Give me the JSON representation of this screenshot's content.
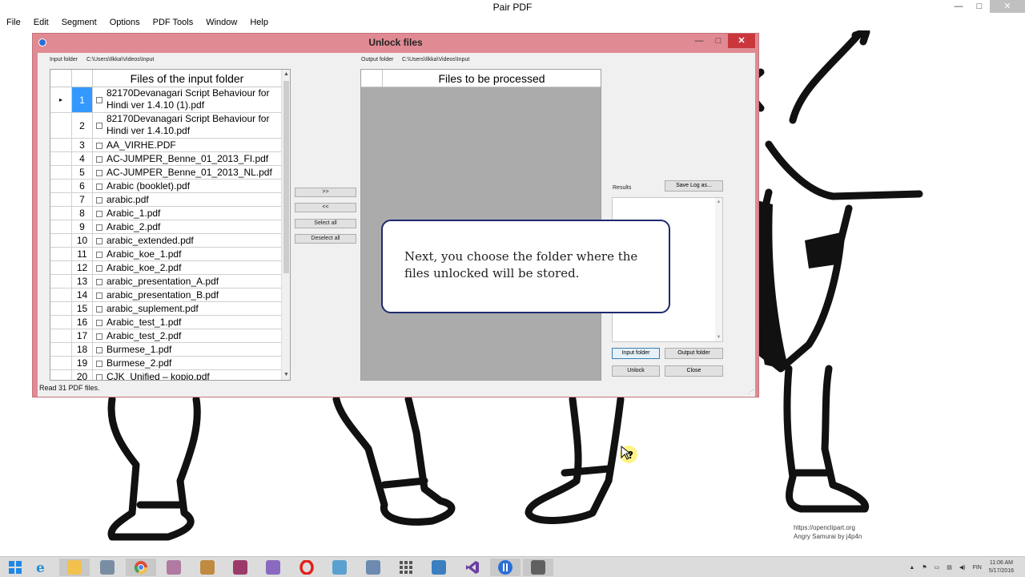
{
  "window": {
    "title": "Pair PDF",
    "caption_min": "—",
    "caption_max": "□",
    "caption_close": "✕"
  },
  "menu": [
    "File",
    "Edit",
    "Segment",
    "Options",
    "PDF Tools",
    "Window",
    "Help"
  ],
  "dialog": {
    "title": "Unlock files",
    "caption_min": "—",
    "caption_max": "□",
    "caption_close": "✕",
    "input_folder_label": "Input folder",
    "input_folder_path": "C:\\Users\\Ilkka\\Videos\\Input",
    "output_folder_label": "Output folder",
    "output_folder_path": "C:\\Users\\Ilkka\\Videos\\Input",
    "input_grid_title": "Files of the input folder",
    "output_grid_title": "Files to be processed",
    "current_row_marker": "▸",
    "scroll_up": "▲",
    "scroll_down": "▼",
    "files": [
      {
        "num": "1",
        "name": "82170Devanagari Script Behaviour for Hindi  ver 1.4.10 (1).pdf",
        "selected": true
      },
      {
        "num": "2",
        "name": "82170Devanagari Script Behaviour for Hindi  ver 1.4.10.pdf"
      },
      {
        "num": "3",
        "name": "AA_VIRHE.PDF"
      },
      {
        "num": "4",
        "name": "AC-JUMPER_Benne_01_2013_FI.pdf"
      },
      {
        "num": "5",
        "name": "AC-JUMPER_Benne_01_2013_NL.pdf"
      },
      {
        "num": "6",
        "name": "Arabic (booklet).pdf"
      },
      {
        "num": "7",
        "name": "arabic.pdf"
      },
      {
        "num": "8",
        "name": "Arabic_1.pdf"
      },
      {
        "num": "9",
        "name": "Arabic_2.pdf"
      },
      {
        "num": "10",
        "name": "arabic_extended.pdf"
      },
      {
        "num": "11",
        "name": "Arabic_koe_1.pdf"
      },
      {
        "num": "12",
        "name": "Arabic_koe_2.pdf"
      },
      {
        "num": "13",
        "name": "arabic_presentation_A.pdf"
      },
      {
        "num": "14",
        "name": "arabic_presentation_B.pdf"
      },
      {
        "num": "15",
        "name": "arabic_suplement.pdf"
      },
      {
        "num": "16",
        "name": "Arabic_test_1.pdf"
      },
      {
        "num": "17",
        "name": "Arabic_test_2.pdf"
      },
      {
        "num": "18",
        "name": "Burmese_1.pdf"
      },
      {
        "num": "19",
        "name": "Burmese_2.pdf"
      },
      {
        "num": "20",
        "name": "CJK_Unified – kopio.pdf"
      }
    ],
    "buttons": {
      "move_right": ">>",
      "move_left": "<<",
      "select_all": "Select all",
      "deselect_all": "Deselect all",
      "save_log": "Save Log as...",
      "input_folder": "Input folder",
      "output_folder": "Output folder",
      "unlock": "Unlock",
      "close": "Close"
    },
    "results_label": "Results",
    "status": "Read 31 PDF files.",
    "resize_grip": "⋰"
  },
  "tooltip": {
    "text": "Next, you choose the folder where the files unlocked will be stored."
  },
  "attribution": {
    "line1": "https://openclipart.org",
    "line2": "Angry Samurai by j4p4n"
  },
  "taskbar": {
    "language": "FIN",
    "time": "11:06 AM",
    "date": "5/17/2016",
    "colors": {
      "windows": "#1e88e5",
      "ie": "#1e90d6",
      "explorer": "#f2c14e",
      "chrome": "#dd4b39",
      "opera": "#e0201b",
      "vs": "#6a3fa0",
      "pairpdf": "#2a6fd6"
    }
  }
}
